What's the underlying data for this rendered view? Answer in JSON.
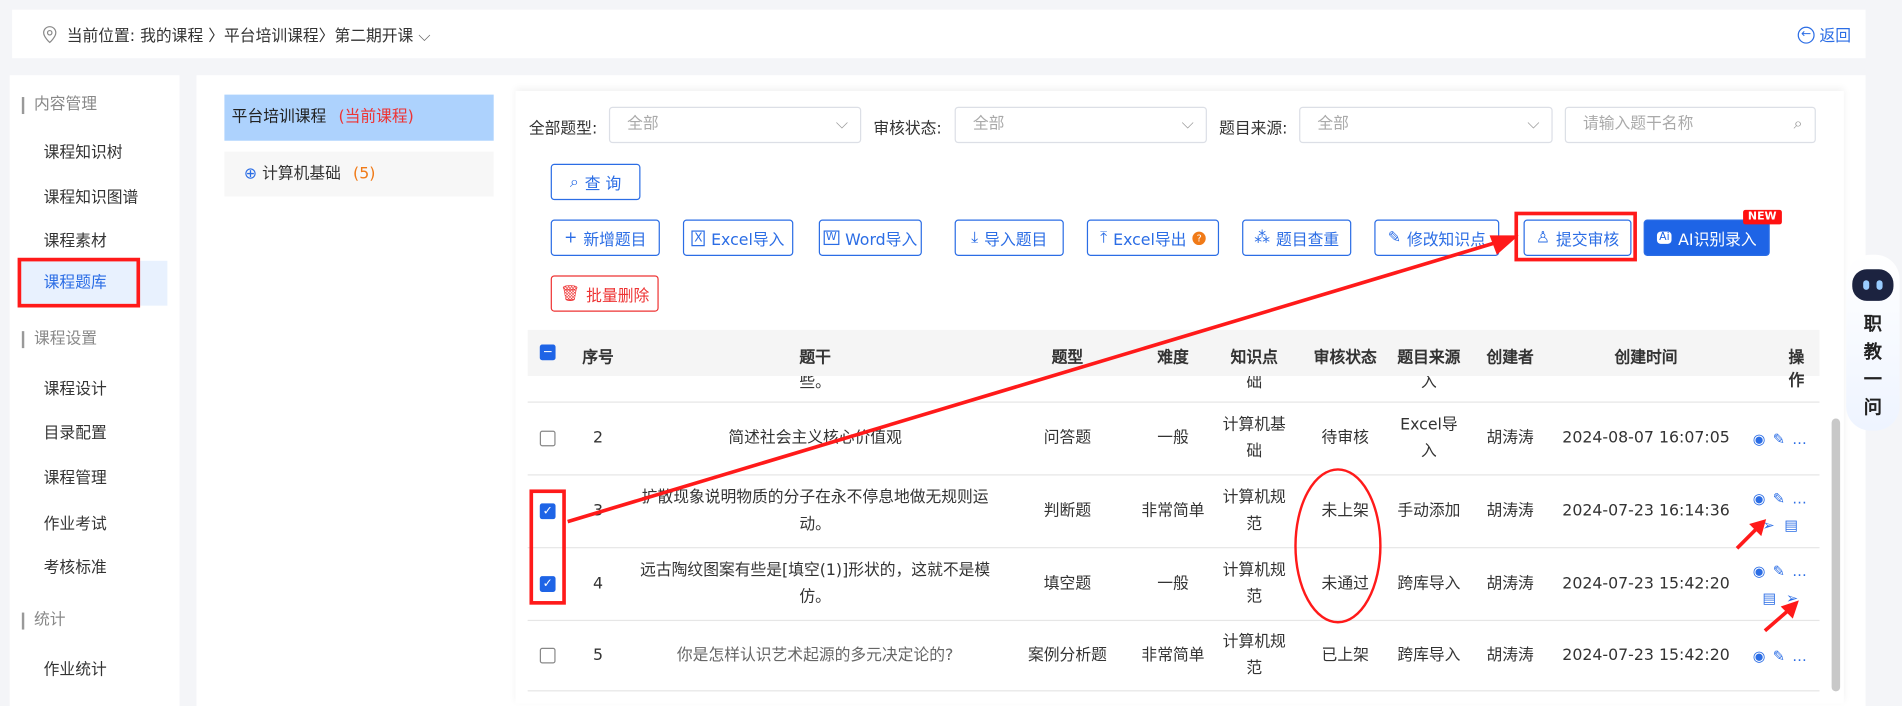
{
  "breadcrumb": {
    "prefix": "当前位置:",
    "items": [
      "我的课程",
      "平台培训课程",
      "第二期开课"
    ],
    "back": "返回"
  },
  "sidebar": {
    "groups": [
      {
        "title": "内容管理",
        "items": [
          "课程知识树",
          "课程知识图谱",
          "课程素材",
          "课程题库"
        ]
      },
      {
        "title": "课程设置",
        "items": [
          "课程设计",
          "目录配置",
          "课程管理",
          "作业考试",
          "考核标准"
        ]
      },
      {
        "title": "统计",
        "items": [
          "作业统计"
        ]
      }
    ],
    "active": "课程题库"
  },
  "tree": {
    "title": "平台培训课程",
    "current": "(当前课程)",
    "node": "计算机基础",
    "count": "(5)"
  },
  "filters": {
    "type_label": "全部题型:",
    "type_value": "全部",
    "status_label": "审核状态:",
    "status_value": "全部",
    "source_label": "题目来源:",
    "source_value": "全部",
    "search_placeholder": "请输入题干名称"
  },
  "toolbar": {
    "query": "查 询",
    "add": "新增题目",
    "excel_import": "Excel导入",
    "word_import": "Word导入",
    "import": "导入题目",
    "excel_export": "Excel导出",
    "dup": "题目查重",
    "edit_kp": "修改知识点",
    "submit": "提交审核",
    "ai": "AI识别录入",
    "new_badge": "NEW",
    "batch_delete": "批量删除"
  },
  "table": {
    "headers": [
      "序号",
      "题干",
      "题型",
      "难度",
      "知识点",
      "审核状态",
      "题目来源",
      "创建者",
      "创建时间",
      "操作"
    ],
    "partial_row": {
      "stem": "些。",
      "kp": "础",
      "source": "入"
    },
    "rows": [
      {
        "checked": false,
        "no": "2",
        "stem": "简述社会主义核心价值观",
        "type": "问答题",
        "difficulty": "一般",
        "kp": "计算机基础",
        "status": "待审核",
        "source": "Excel导入",
        "creator": "胡涛涛",
        "time": "2024-08-07 16:07:05",
        "extra_icons": []
      },
      {
        "checked": true,
        "no": "3",
        "stem": "扩散现象说明物质的分子在永不停息地做无规则运动。",
        "type": "判断题",
        "difficulty": "非常简单",
        "kp": "计算机规范",
        "status": "未上架",
        "source": "手动添加",
        "creator": "胡涛涛",
        "time": "2024-07-23 16:14:36",
        "extra_icons": [
          "send-icon",
          "doc-icon"
        ]
      },
      {
        "checked": true,
        "no": "4",
        "stem": "远古陶纹图案有些是[填空(1)]形状的，这就不是模仿。",
        "type": "填空题",
        "difficulty": "一般",
        "kp": "计算机规范",
        "status": "未通过",
        "source": "跨库导入",
        "creator": "胡涛涛",
        "time": "2024-07-23 15:42:20",
        "extra_icons": [
          "doc-icon",
          "send-icon"
        ]
      },
      {
        "checked": false,
        "no": "5",
        "stem": "你是怎样认识艺术起源的多元决定论的?",
        "type": "案例分析题",
        "difficulty": "非常简单",
        "kp": "计算机规范",
        "status": "已上架",
        "source": "跨库导入",
        "creator": "胡涛涛",
        "time": "2024-07-23 15:42:20",
        "extra_icons": []
      }
    ]
  },
  "assistant": {
    "label": "职教一问"
  },
  "colors": {
    "primary": "#1e64e6",
    "danger": "#ee3333",
    "annotation": "#ff1a1a"
  }
}
